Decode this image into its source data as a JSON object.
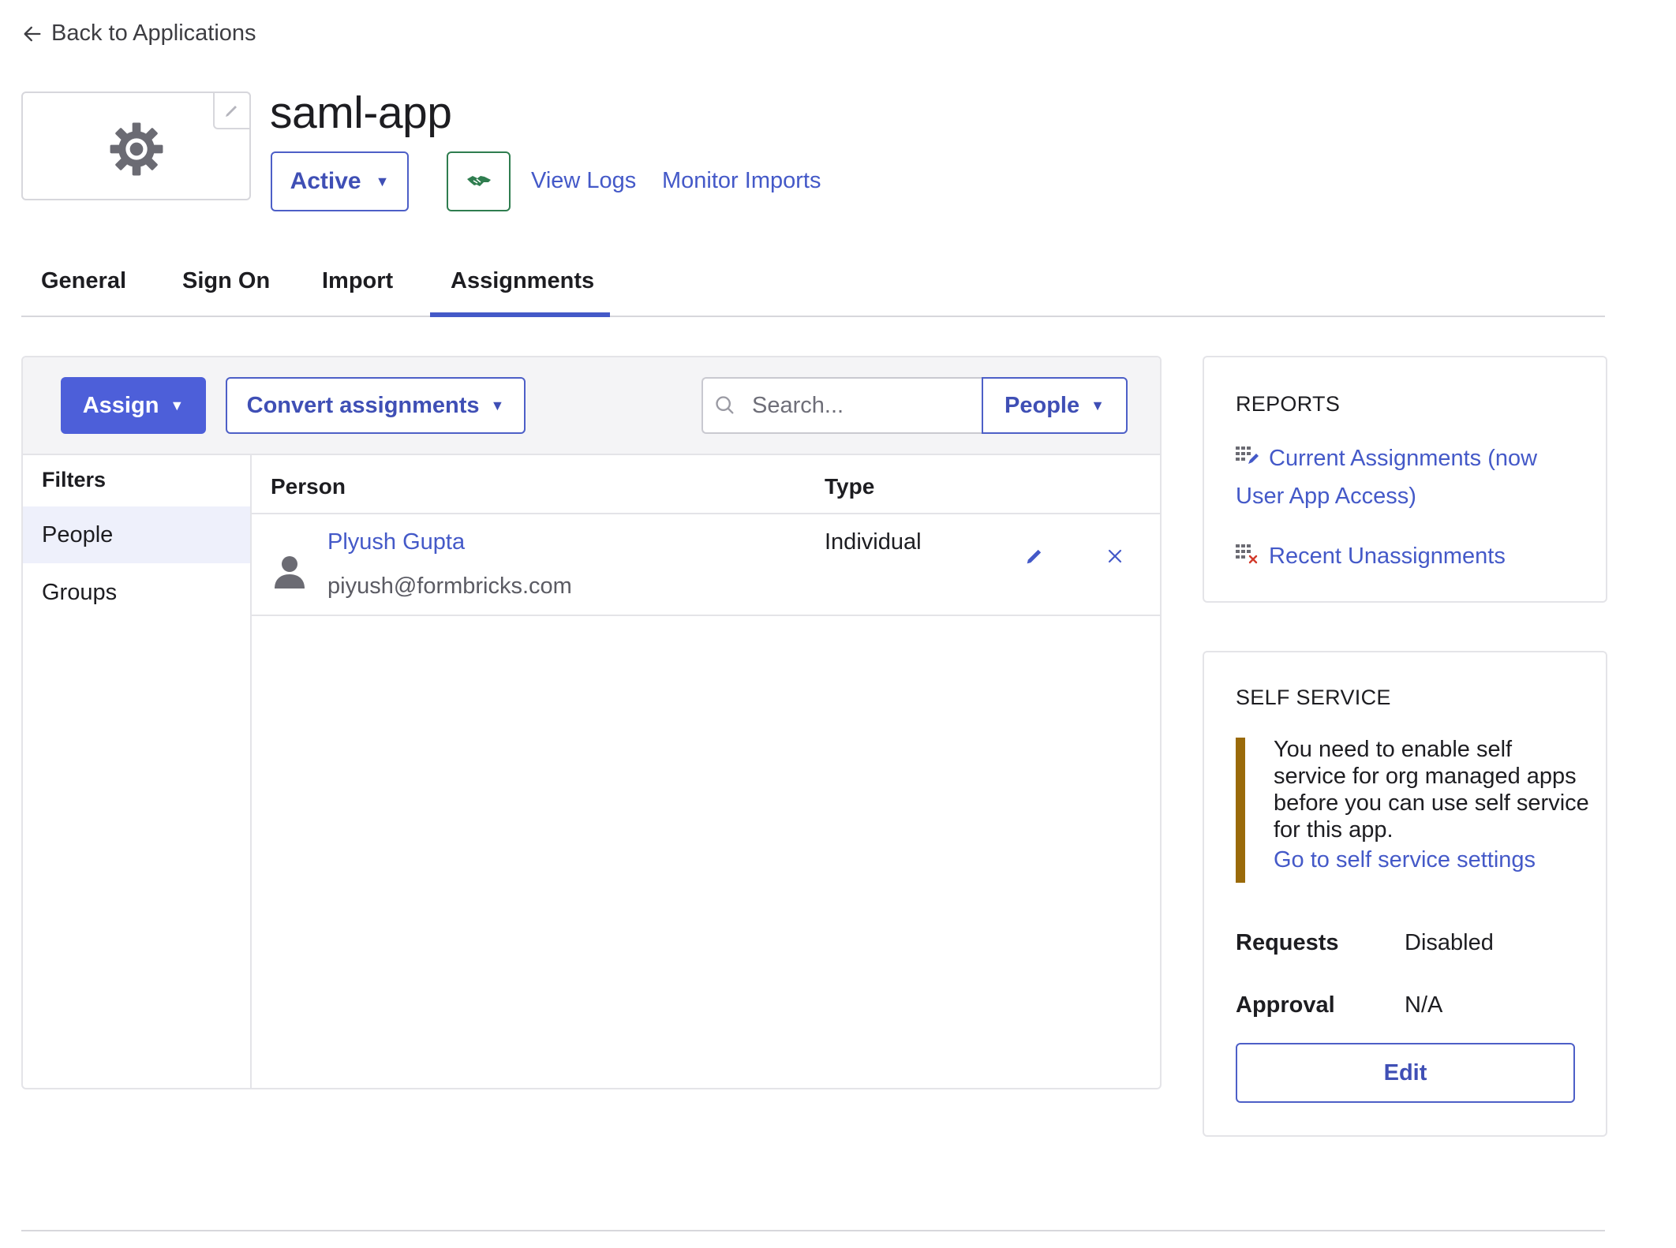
{
  "header": {
    "back_link": "Back to Applications",
    "app_title": "saml-app",
    "status_label": "Active",
    "links": {
      "view_logs": "View Logs",
      "monitor_imports": "Monitor Imports"
    }
  },
  "tabs": [
    {
      "label": "General"
    },
    {
      "label": "Sign On"
    },
    {
      "label": "Import"
    },
    {
      "label": "Assignments",
      "active": true
    }
  ],
  "toolbar": {
    "assign_label": "Assign",
    "convert_label": "Convert assignments",
    "search_placeholder": "Search...",
    "filter_dropdown": "People"
  },
  "filters": {
    "title": "Filters",
    "items": [
      {
        "label": "People",
        "selected": true
      },
      {
        "label": "Groups"
      }
    ]
  },
  "table": {
    "columns": [
      "Person",
      "Type"
    ],
    "rows": [
      {
        "name": "Plyush Gupta",
        "email": "piyush@formbricks.com",
        "type": "Individual"
      }
    ]
  },
  "reports": {
    "title": "REPORTS",
    "links": [
      {
        "label_line1": "Current Assignments (now",
        "label_line2": "User App Access)",
        "icon": "assignments-report-icon"
      },
      {
        "label": "Recent Unassignments",
        "icon": "unassignments-report-icon"
      }
    ]
  },
  "self_service": {
    "title": "SELF SERVICE",
    "notice": "You need to enable self service for org managed apps before you can use self service for this app.",
    "notice_link": "Go to self service settings",
    "requests_label": "Requests",
    "requests_value": "Disabled",
    "approval_label": "Approval",
    "approval_value": "N/A",
    "edit_label": "Edit"
  },
  "colors": {
    "accent": "#4459c8",
    "primary_button": "#4d5fd9",
    "success_border": "#2f7d4f",
    "warning_bar": "#9a6a0a"
  }
}
